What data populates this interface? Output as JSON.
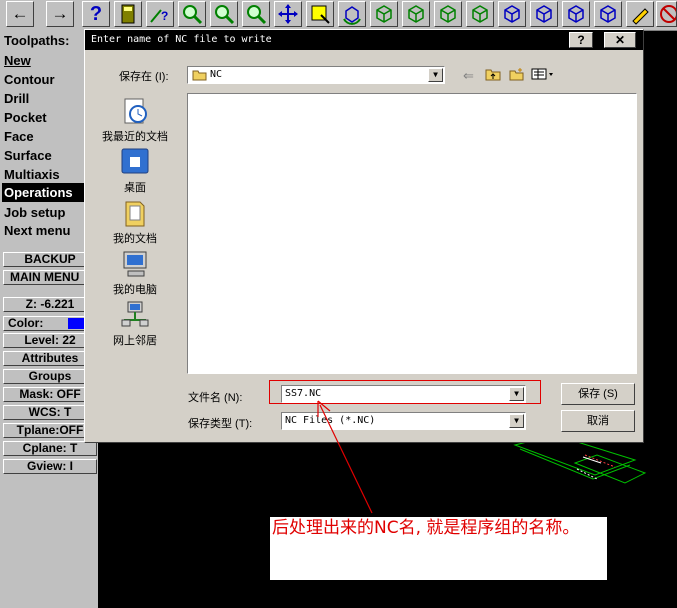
{
  "menu": {
    "header": "Toolpaths:",
    "items": [
      "New",
      "Contour",
      "Drill",
      "Pocket",
      "Face",
      "Surface",
      "Multiaxis",
      "Operations",
      "Job setup",
      "Next menu"
    ],
    "backup": "BACKUP",
    "main_menu": "MAIN MENU",
    "z": "Z:  -6.221",
    "color_label": "Color:",
    "level": "Level: 22",
    "attributes": "Attributes",
    "groups": "Groups",
    "mask": "Mask:  OFF",
    "wcs": "WCS:   T",
    "tplane": "Tplane:OFF",
    "cplane": "Cplane:  T",
    "gview": "Gview:   I",
    "color_swatch": "#0000ff"
  },
  "dialog": {
    "title": "Enter name of NC file to write",
    "help_btn": "?",
    "close_btn": "✕",
    "save_in_label": "保存在 (I):",
    "save_in_value": "NC",
    "places": [
      "我最近的文档",
      "桌面",
      "我的文档",
      "我的电脑",
      "网上邻居"
    ],
    "filename_label": "文件名 (N):",
    "filename_value": "SS7.NC",
    "filetype_label": "保存类型 (T):",
    "filetype_value": "NC Files (*.NC)",
    "save_btn": "保存 (S)",
    "cancel_btn": "取消"
  },
  "annotation": {
    "text": "后处理出来的NC名, 就是程序组的名称。",
    "color": "#e00000"
  }
}
